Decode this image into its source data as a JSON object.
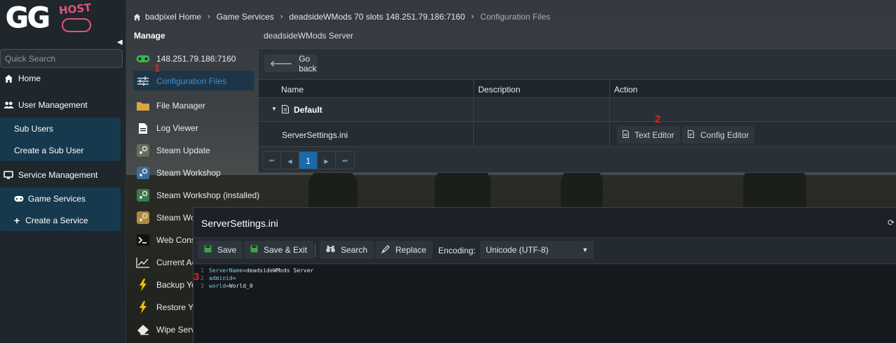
{
  "sidebar": {
    "logo_host": "HOST",
    "search_placeholder": "Quick Search",
    "nav": {
      "home": "Home",
      "user_management": "User Management",
      "sub_users": "Sub Users",
      "create_sub_user": "Create a Sub User",
      "service_management": "Service Management",
      "game_services": "Game Services",
      "create_service": "Create a Service"
    }
  },
  "breadcrumb": {
    "items": [
      "badpixel Home",
      "Game Services",
      "deadsideWMods 70 slots 148.251.79.186:7160",
      "Configuration Files"
    ]
  },
  "manage": {
    "title": "Manage",
    "server_title": "deadsideWMods Server",
    "items": [
      {
        "label": "148.251.79.186:7160",
        "icon": "gamepad-icon"
      },
      {
        "label": "Configuration Files",
        "icon": "sliders-icon"
      },
      {
        "label": "File Manager",
        "icon": "folder-icon"
      },
      {
        "label": "Log Viewer",
        "icon": "file-icon"
      },
      {
        "label": "Steam Update",
        "icon": "steam-icon"
      },
      {
        "label": "Steam Workshop",
        "icon": "steam-icon"
      },
      {
        "label": "Steam Workshop (installed)",
        "icon": "steam-icon"
      },
      {
        "label": "Steam Wo",
        "icon": "steam-icon"
      },
      {
        "label": "Web Cons",
        "icon": "terminal-icon"
      },
      {
        "label": "Current Ac",
        "icon": "chart-icon"
      },
      {
        "label": "Backup Yo",
        "icon": "lightning-icon"
      },
      {
        "label": "Restore Yo",
        "icon": "lightning-icon"
      },
      {
        "label": "Wipe Serve",
        "icon": "eraser-icon"
      }
    ]
  },
  "annotations": {
    "one": "1",
    "two": "2",
    "three": "3"
  },
  "config_panel": {
    "go_back": "Go back",
    "columns": [
      "Name",
      "Description",
      "Action"
    ],
    "group": "Default",
    "row": {
      "name": "ServerSettings.ini",
      "description": ""
    },
    "actions": {
      "text_editor": "Text Editor",
      "config_editor": "Config Editor"
    },
    "pager": {
      "first": "⏮",
      "prev": "◀",
      "page": "1",
      "next": "▶",
      "last": "⏭"
    }
  },
  "editor": {
    "title": "ServerSettings.ini",
    "toolbar": {
      "save": "Save",
      "save_exit": "Save & Exit",
      "search": "Search",
      "replace": "Replace",
      "encoding_label": "Encoding:",
      "encoding_value": "Unicode (UTF-8)"
    },
    "lines": [
      {
        "num": "1",
        "key": "ServerName",
        "eq": "=",
        "value": "deadsideWMods Server"
      },
      {
        "num": "2",
        "key": "adminid",
        "eq": "=",
        "value": ""
      },
      {
        "num": "3",
        "key": "world",
        "eq": "=",
        "value": "World_0"
      }
    ]
  },
  "colors": {
    "accent_blue": "#1a6aa8",
    "annotation_red": "#e02424",
    "submenu_bg": "#16394e",
    "logo_pink": "#e2547a"
  }
}
